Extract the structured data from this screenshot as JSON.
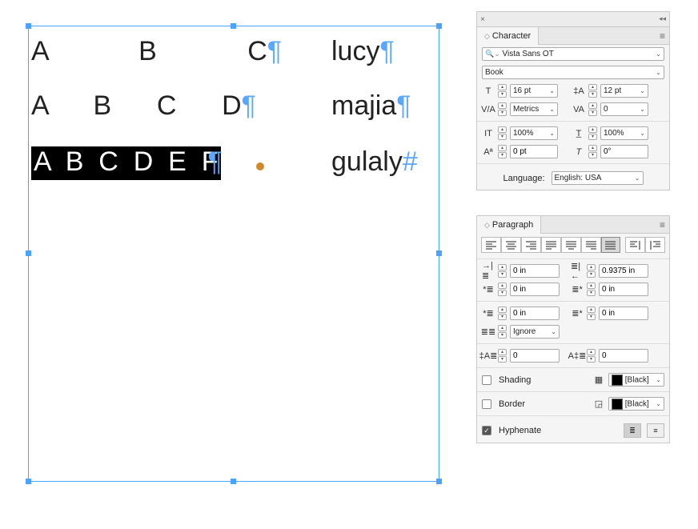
{
  "document": {
    "line1_left": "A            B            C",
    "line1_right": "lucy",
    "line2_left": "A      B      C      D",
    "line2_right": "majia",
    "line3_left": "A  B  C  D  E  F",
    "line3_right": "gulaly"
  },
  "character": {
    "tab_label": "Character",
    "font_family": "Vista Sans OT",
    "font_style": "Book",
    "font_size": "16 pt",
    "leading": "12 pt",
    "kerning": "Metrics",
    "tracking": "0",
    "vscale": "100%",
    "hscale": "100%",
    "baseline": "0 pt",
    "skew": "0°",
    "language_label": "Language:",
    "language": "English: USA"
  },
  "paragraph": {
    "tab_label": "Paragraph",
    "left_indent": "0 in",
    "right_indent": "0.9375 in",
    "first_indent": "0 in",
    "last_indent": "0 in",
    "space_before": "0 in",
    "space_after": "0 in",
    "span": "Ignore",
    "drop_lines": "0",
    "drop_chars": "0",
    "shading_label": "Shading",
    "shading_swatch": "[Black]",
    "border_label": "Border",
    "border_swatch": "[Black]",
    "hyphenate_label": "Hyphenate"
  }
}
